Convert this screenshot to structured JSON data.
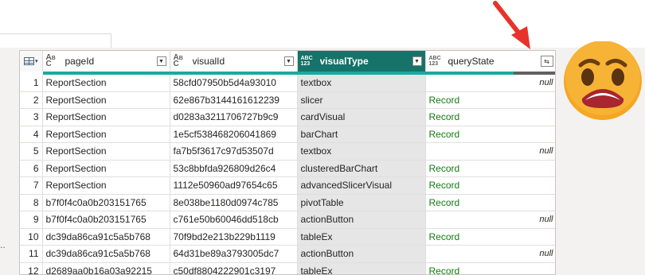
{
  "columns": [
    {
      "type_top": "A",
      "type_sub": "B",
      "type_bottom": "C",
      "name": "pageId"
    },
    {
      "type_top": "A",
      "type_sub": "B",
      "type_bottom": "C",
      "name": "visualId"
    },
    {
      "type_top": "ABC",
      "type_bottom": "123",
      "name": "visualType"
    },
    {
      "type_top": "ABC",
      "type_bottom": "123",
      "name": "queryState"
    }
  ],
  "rows": [
    {
      "n": "1",
      "pageId": "ReportSection",
      "visualId": "58cfd07950b5d4a93010",
      "visualType": "textbox",
      "queryState": "null"
    },
    {
      "n": "2",
      "pageId": "ReportSection",
      "visualId": "62e867b3144161612239",
      "visualType": "slicer",
      "queryState": "Record"
    },
    {
      "n": "3",
      "pageId": "ReportSection",
      "visualId": "d0283a3211706727b9c9",
      "visualType": "cardVisual",
      "queryState": "Record"
    },
    {
      "n": "4",
      "pageId": "ReportSection",
      "visualId": "1e5cf538468206041869",
      "visualType": "barChart",
      "queryState": "Record"
    },
    {
      "n": "5",
      "pageId": "ReportSection",
      "visualId": "fa7b5f3617c97d53507d",
      "visualType": "textbox",
      "queryState": "null"
    },
    {
      "n": "6",
      "pageId": "ReportSection",
      "visualId": "53c8bbfda926809d26c4",
      "visualType": "clusteredBarChart",
      "queryState": "Record"
    },
    {
      "n": "7",
      "pageId": "ReportSection",
      "visualId": "1112e50960ad97654c65",
      "visualType": "advancedSlicerVisual",
      "queryState": "Record"
    },
    {
      "n": "8",
      "pageId": "b7f0f4c0a0b203151765",
      "visualId": "8e038be1180d0974c785",
      "visualType": "pivotTable",
      "queryState": "Record"
    },
    {
      "n": "9",
      "pageId": "b7f0f4c0a0b203151765",
      "visualId": "c761e50b60046dd518cb",
      "visualType": "actionButton",
      "queryState": "null"
    },
    {
      "n": "10",
      "pageId": "dc39da86ca91c5a5b768",
      "visualId": "70f9bd2e213b229b1119",
      "visualType": "tableEx",
      "queryState": "Record"
    },
    {
      "n": "11",
      "pageId": "dc39da86ca91c5a5b768",
      "visualId": "64d31be89a3793005dc7",
      "visualType": "actionButton",
      "queryState": "null"
    },
    {
      "n": "12",
      "pageId": "d2689aa0b16a03a92215",
      "visualId": "c50df8804222901c3197",
      "visualType": "tableEx",
      "queryState": "Record"
    }
  ],
  "side_text": "..",
  "colors": {
    "selected_header": "#157369",
    "column_quality_bar": "#1ba9a0",
    "record_link": "#107c10",
    "arrow": "#e8332b",
    "emoji_face": "#f5a623",
    "emoji_mouth": "#d9363e"
  },
  "icons": {
    "table_menu": "table-icon",
    "expand_column": "expand-columns-icon",
    "annotation_arrow": "red-arrow-icon",
    "reaction": "shocked-face-emoji-icon"
  }
}
